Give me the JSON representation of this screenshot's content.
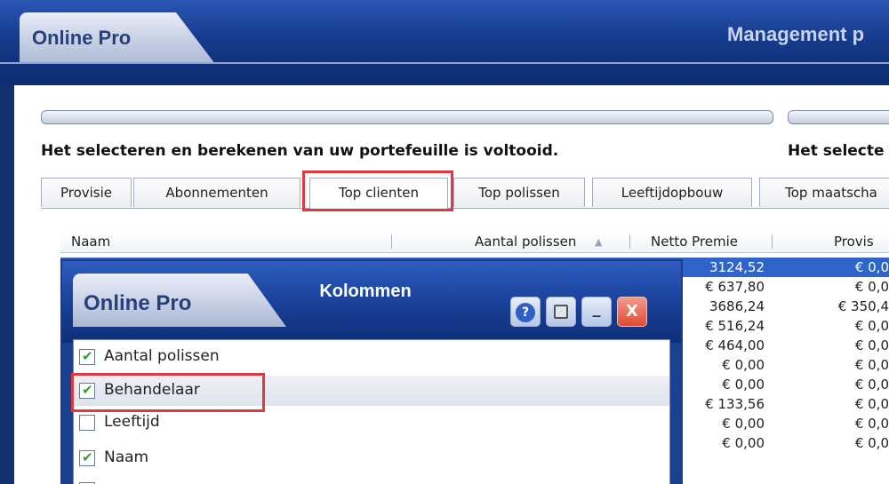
{
  "app": {
    "title": "Online Pro",
    "subtitle": "Management p"
  },
  "status": {
    "left": "Het selecteren en berekenen van uw portefeuille is voltooid.",
    "right": "Het selecte"
  },
  "tabs": [
    {
      "label": "Provisie"
    },
    {
      "label": "Abonnementen"
    },
    {
      "label": "Top clienten",
      "active": true
    },
    {
      "label": "Top polissen"
    },
    {
      "label": "Leeftijdopbouw"
    },
    {
      "label": "Top maatscha"
    }
  ],
  "grid": {
    "columns": [
      "Naam",
      "Aantal polissen",
      "Netto Premie",
      "Provis"
    ],
    "rows": [
      {
        "premie": "3124,52",
        "provisie": "€ 0,0",
        "selected": true
      },
      {
        "premie": "€ 637,80",
        "provisie": "€ 0,0"
      },
      {
        "premie": "3686,24",
        "provisie": "€ 350,4"
      },
      {
        "premie": "€ 516,24",
        "provisie": "€ 0,0"
      },
      {
        "premie": "€ 464,00",
        "provisie": "€ 0,0"
      },
      {
        "premie": "€ 0,00",
        "provisie": "€ 0,0"
      },
      {
        "premie": "€ 0,00",
        "provisie": "€ 0,0"
      },
      {
        "premie": "€ 133,56",
        "provisie": "€ 0,0"
      },
      {
        "premie": "€ 0,00",
        "provisie": "€ 0,0"
      },
      {
        "premie": "€ 0,00",
        "provisie": "€ 0,0"
      }
    ]
  },
  "dialog": {
    "app_title": "Online Pro",
    "caption": "Kolommen",
    "buttons": {
      "help": "?",
      "minimize": "_",
      "close": "X"
    },
    "items": [
      {
        "label": "Aantal polissen",
        "checked": true
      },
      {
        "label": "Behandelaar",
        "checked": true,
        "selected": true
      },
      {
        "label": "Leeftijd",
        "checked": false
      },
      {
        "label": "Naam",
        "checked": true
      }
    ]
  },
  "colors": {
    "highlight": "#e0393e",
    "selection": "#2f64c8",
    "chrome": "#163b8c"
  }
}
